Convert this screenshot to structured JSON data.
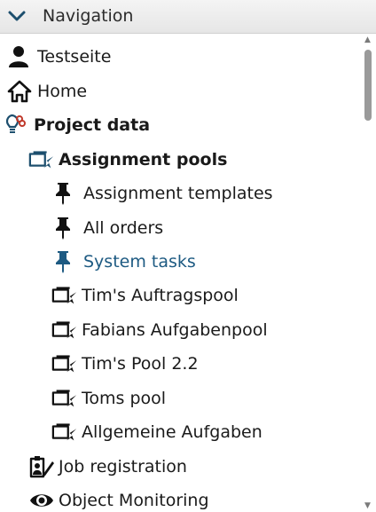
{
  "header": {
    "title": "Navigation",
    "icon": "chevron-down-icon",
    "accent": "#1d4f6e"
  },
  "tree": {
    "items": [
      {
        "label": "Testseite",
        "icon": "user-icon"
      },
      {
        "label": "Home",
        "icon": "home-icon"
      },
      {
        "label": "Project data",
        "icon": "project-data-icon",
        "bold": true
      },
      {
        "label": "Assignment pools",
        "icon": "assignment-pool-icon",
        "bold": true
      },
      {
        "label": "Assignment templates",
        "icon": "pushpin-icon"
      },
      {
        "label": "All orders",
        "icon": "pushpin-icon"
      },
      {
        "label": "System tasks",
        "icon": "pushpin-icon",
        "active": true
      },
      {
        "label": "Tim's Auftragspool",
        "icon": "pool-icon"
      },
      {
        "label": "Fabians Aufgabenpool",
        "icon": "pool-icon"
      },
      {
        "label": "Tim's Pool 2.2",
        "icon": "pool-icon"
      },
      {
        "label": "Toms pool",
        "icon": "pool-icon"
      },
      {
        "label": "Allgemeine Aufgaben",
        "icon": "pool-icon"
      },
      {
        "label": "Job registration",
        "icon": "job-registration-icon"
      },
      {
        "label": "Object Monitoring",
        "icon": "eye-icon"
      }
    ]
  },
  "colors": {
    "active_text": "#1d5a82",
    "icon_dark": "#111111",
    "icon_blue": "#1d4f6e",
    "icon_red": "#c0392b"
  }
}
